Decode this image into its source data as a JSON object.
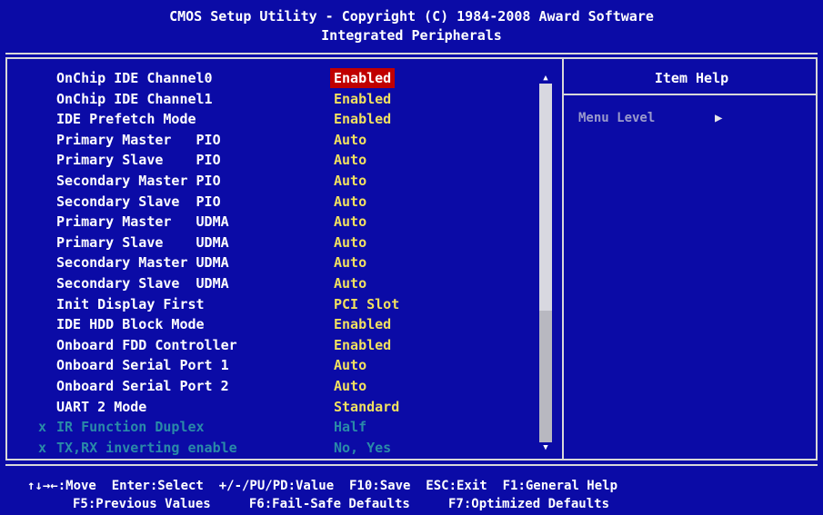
{
  "header": {
    "title": "CMOS Setup Utility - Copyright (C) 1984-2008 Award Software",
    "subtitle": "Integrated Peripherals"
  },
  "settings": [
    {
      "label": "OnChip IDE Channel0",
      "value": "Enabled",
      "state": "selected"
    },
    {
      "label": "OnChip IDE Channel1",
      "value": "Enabled",
      "state": "normal"
    },
    {
      "label": "IDE Prefetch Mode",
      "value": "Enabled",
      "state": "normal"
    },
    {
      "label": "Primary Master   PIO",
      "value": "Auto",
      "state": "normal"
    },
    {
      "label": "Primary Slave    PIO",
      "value": "Auto",
      "state": "normal"
    },
    {
      "label": "Secondary Master PIO",
      "value": "Auto",
      "state": "normal"
    },
    {
      "label": "Secondary Slave  PIO",
      "value": "Auto",
      "state": "normal"
    },
    {
      "label": "Primary Master   UDMA",
      "value": "Auto",
      "state": "normal"
    },
    {
      "label": "Primary Slave    UDMA",
      "value": "Auto",
      "state": "normal"
    },
    {
      "label": "Secondary Master UDMA",
      "value": "Auto",
      "state": "normal"
    },
    {
      "label": "Secondary Slave  UDMA",
      "value": "Auto",
      "state": "normal"
    },
    {
      "label": "Init Display First",
      "value": "PCI Slot",
      "state": "normal"
    },
    {
      "label": "IDE HDD Block Mode",
      "value": "Enabled",
      "state": "normal"
    },
    {
      "label": "Onboard FDD Controller",
      "value": "Enabled",
      "state": "normal"
    },
    {
      "label": "Onboard Serial Port 1",
      "value": "Auto",
      "state": "normal"
    },
    {
      "label": "Onboard Serial Port 2",
      "value": "Auto",
      "state": "normal"
    },
    {
      "label": "UART 2 Mode",
      "value": "Standard",
      "state": "normal"
    },
    {
      "label": "IR Function Duplex",
      "value": "Half",
      "state": "disabled",
      "mark": "x"
    },
    {
      "label": "TX,RX inverting enable",
      "value": "No, Yes",
      "state": "disabled",
      "mark": "x"
    }
  ],
  "help": {
    "title": "Item Help",
    "menu_level_label": "Menu Level",
    "menu_level_glyph": "▶"
  },
  "footer": {
    "line1": "↑↓→←:Move  Enter:Select  +/-/PU/PD:Value  F10:Save  ESC:Exit  F1:General Help",
    "line2": "F5:Previous Values     F6:Fail-Safe Defaults     F7:Optimized Defaults"
  },
  "colors": {
    "background": "#0b0ba6",
    "label": "#ffffff",
    "value": "#f0e060",
    "disabled": "#2a8aa8",
    "highlight": "#c00000"
  },
  "icons": {
    "scroll_up": "up-arrow-icon",
    "scroll_down": "down-arrow-icon",
    "menu_level": "right-triangle-icon"
  }
}
